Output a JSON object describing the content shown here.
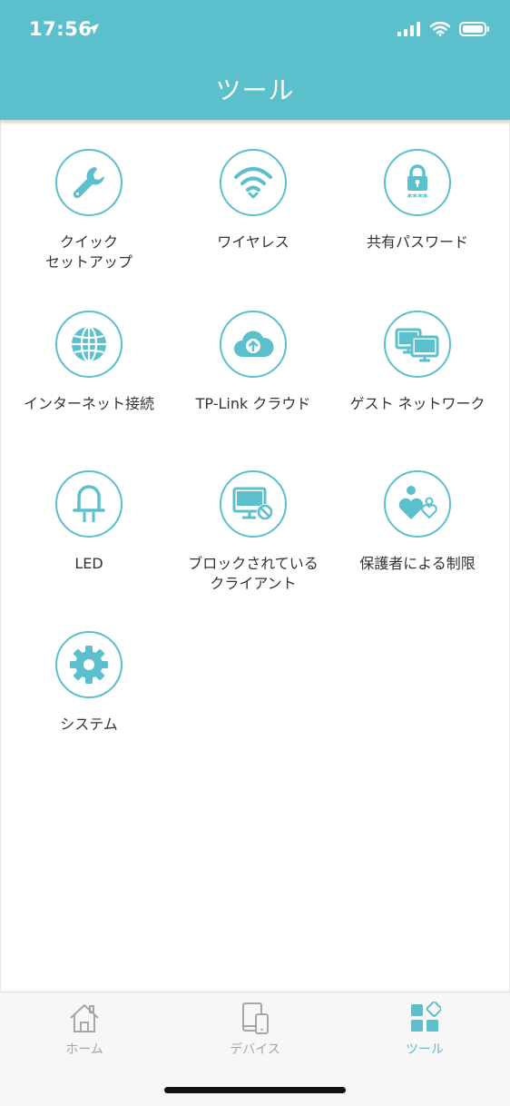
{
  "status_bar": {
    "time": "17:56"
  },
  "header": {
    "title": "ツール"
  },
  "colors": {
    "accent": "#5bbfcc",
    "header_bg": "#5bbfcc",
    "tab_inactive": "#a6a6a6"
  },
  "tools": [
    {
      "label": "クイック\nセットアップ",
      "icon": "wrench-icon"
    },
    {
      "label": "ワイヤレス",
      "icon": "wifi-icon"
    },
    {
      "label": "共有パスワード",
      "icon": "lock-password-icon"
    },
    {
      "label": "インターネット接続",
      "icon": "globe-icon"
    },
    {
      "label": "TP-Link クラウド",
      "icon": "cloud-upload-icon"
    },
    {
      "label": "ゲスト ネットワーク",
      "icon": "monitors-icon"
    },
    {
      "label": "LED",
      "icon": "led-bulb-icon"
    },
    {
      "label": "ブロックされている\nクライアント",
      "icon": "blocked-monitor-icon"
    },
    {
      "label": "保護者による制限",
      "icon": "parental-heart-icon"
    },
    {
      "label": "システム",
      "icon": "gear-icon"
    }
  ],
  "tabs": [
    {
      "label": "ホーム",
      "icon": "house-icon",
      "active": false
    },
    {
      "label": "デバイス",
      "icon": "devices-icon",
      "active": false
    },
    {
      "label": "ツール",
      "icon": "tools-grid-icon",
      "active": true
    }
  ]
}
